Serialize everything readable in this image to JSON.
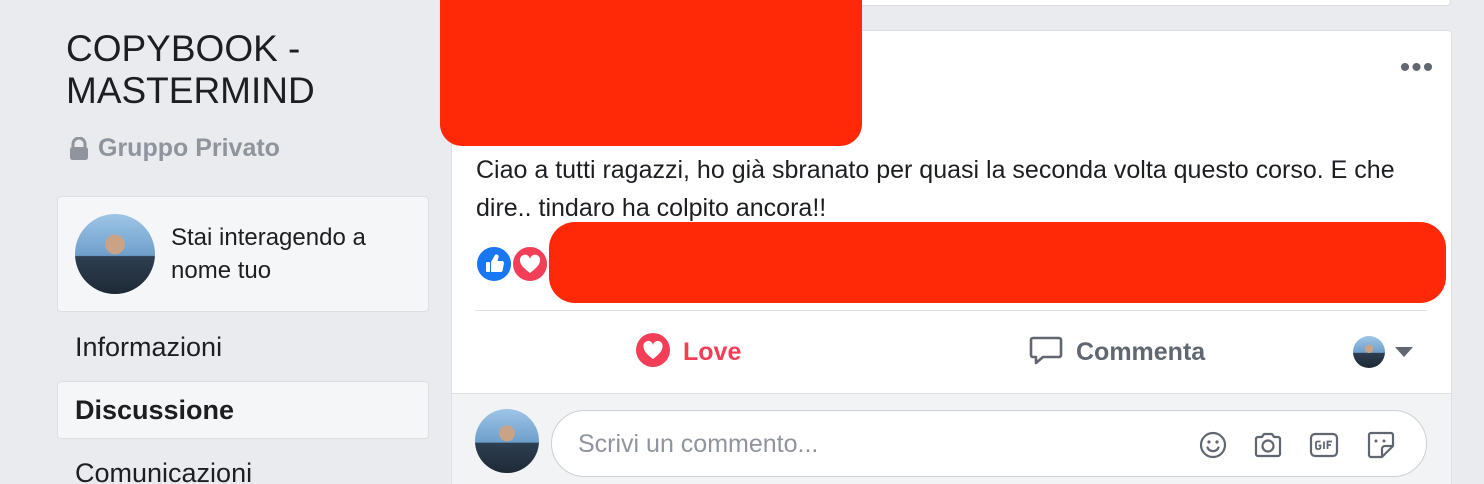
{
  "group": {
    "title": "COPYBOOK - MASTERMIND",
    "privacy": "Gruppo Privato"
  },
  "identity": {
    "text": "Stai interagendo a nome tuo"
  },
  "nav": {
    "items": [
      "Informazioni",
      "Discussione",
      "Comunicazioni"
    ],
    "active": "Discussione"
  },
  "post": {
    "text": "Ciao a tutti ragazzi, ho già sbranato per quasi la seconda volta questo corso. E che dire.. tindaro ha colpito ancora!!",
    "more_label": "•••",
    "reactions": [
      "like-icon",
      "love-icon"
    ]
  },
  "actions": {
    "love_label": "Love",
    "comment_label": "Commenta"
  },
  "comment": {
    "placeholder": "Scrivi un commento..."
  },
  "colors": {
    "love": "#f33e58",
    "like": "#1877f2",
    "redaction": "#ff2807"
  }
}
